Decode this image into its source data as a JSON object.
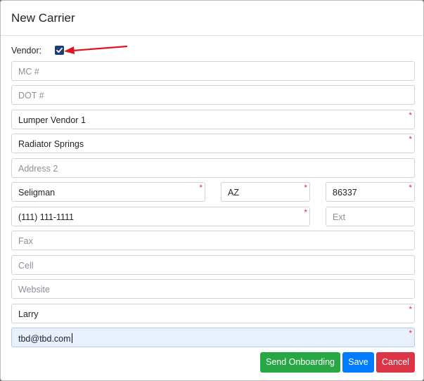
{
  "modal": {
    "title": "New Carrier"
  },
  "vendor": {
    "label": "Vendor:",
    "checked": true
  },
  "fields": {
    "mc": {
      "placeholder": "MC #"
    },
    "dot": {
      "placeholder": "DOT #"
    },
    "name": {
      "value": "Lumper Vendor 1",
      "required": "*"
    },
    "address1": {
      "value": "Radiator Springs",
      "required": "*"
    },
    "address2": {
      "placeholder": "Address 2"
    },
    "city": {
      "value": "Seligman",
      "required": "*"
    },
    "state": {
      "value": "AZ",
      "required": "*"
    },
    "zip": {
      "value": "86337",
      "required": "*"
    },
    "phone": {
      "value": "(111) 111-1111",
      "required": "*"
    },
    "ext": {
      "placeholder": "Ext"
    },
    "fax": {
      "placeholder": "Fax"
    },
    "cell": {
      "placeholder": "Cell"
    },
    "website": {
      "placeholder": "Website"
    },
    "contact": {
      "value": "Larry",
      "required": "*"
    },
    "email": {
      "value": "tbd@tbd.com",
      "required": "*"
    }
  },
  "buttons": {
    "send_onboarding": "Send Onboarding",
    "save": "Save",
    "cancel": "Cancel"
  },
  "colors": {
    "success": "#28a745",
    "primary": "#007bff",
    "danger": "#dc3545",
    "checkbox": "#1f3d72",
    "annotation_arrow": "#e0141e"
  }
}
